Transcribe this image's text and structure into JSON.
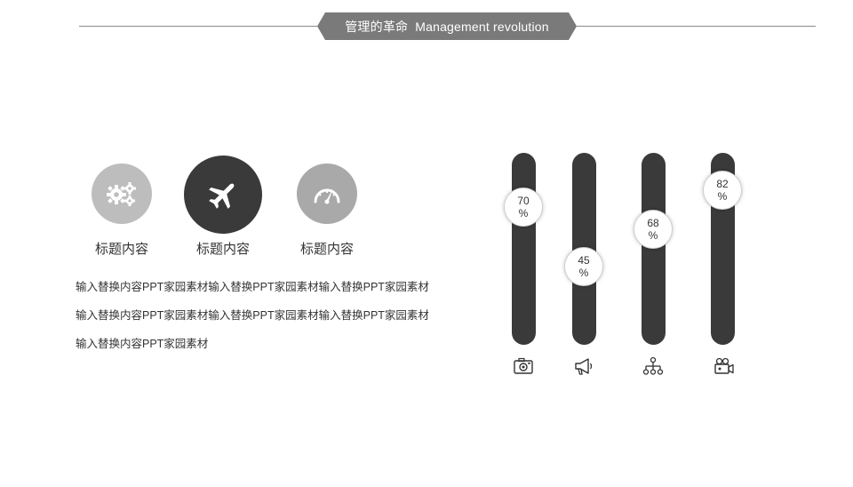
{
  "header": {
    "title_cn": "管理的革命",
    "title_en": "Management revolution"
  },
  "features": [
    {
      "label": "标题内容",
      "icon": "gears-icon",
      "color": "#bdbdbd"
    },
    {
      "label": "标题内容",
      "icon": "airplane-icon",
      "color": "#3a3a3a"
    },
    {
      "label": "标题内容",
      "icon": "speedometer-icon",
      "color": "#a9a9a9"
    }
  ],
  "paragraph": {
    "line1": "输入替换内容PPT家园素材输入替换PPT家园素材输入替换PPT家园素材",
    "line2": "输入替换内容PPT家园素材输入替换PPT家园素材输入替换PPT家园素材",
    "line3": "输入替换内容PPT家园素材"
  },
  "bars": [
    {
      "value": 70,
      "unit": "%",
      "icon": "camera-icon"
    },
    {
      "value": 45,
      "unit": "%",
      "icon": "megaphone-icon"
    },
    {
      "value": 68,
      "unit": "%",
      "icon": "org-chart-icon"
    },
    {
      "value": 82,
      "unit": "%",
      "icon": "video-camera-icon"
    }
  ],
  "colors": {
    "bar": "#3a3a3a",
    "banner": "#7a7a7a",
    "line": "#8a8a8a"
  }
}
